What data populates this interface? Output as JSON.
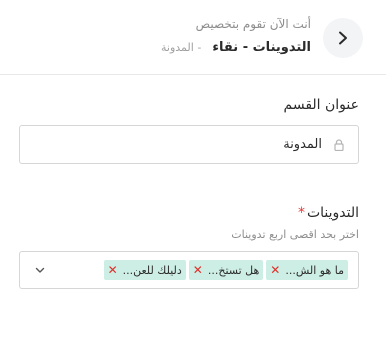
{
  "header": {
    "subtitle": "أنت الآن تقوم بتخصيص",
    "title": "التدوينات - نقاء",
    "breadcrumb": "المدونة",
    "breadcrumb_separator": "-"
  },
  "section_field": {
    "label": "عنوان القسم",
    "value": "المدونة"
  },
  "posts_field": {
    "label": "التدوينات",
    "required_mark": "*",
    "hint": "اختر بحد اقصى اربع تدوينات",
    "selected": [
      {
        "label": "ما هو الش..."
      },
      {
        "label": "هل تستخ..."
      },
      {
        "label": "دليلك للعن..."
      }
    ],
    "remove_symbol": "✕"
  },
  "colors": {
    "chip_bg": "#cdeee4",
    "remove_icon": "#e0302a",
    "required": "#e53935"
  }
}
